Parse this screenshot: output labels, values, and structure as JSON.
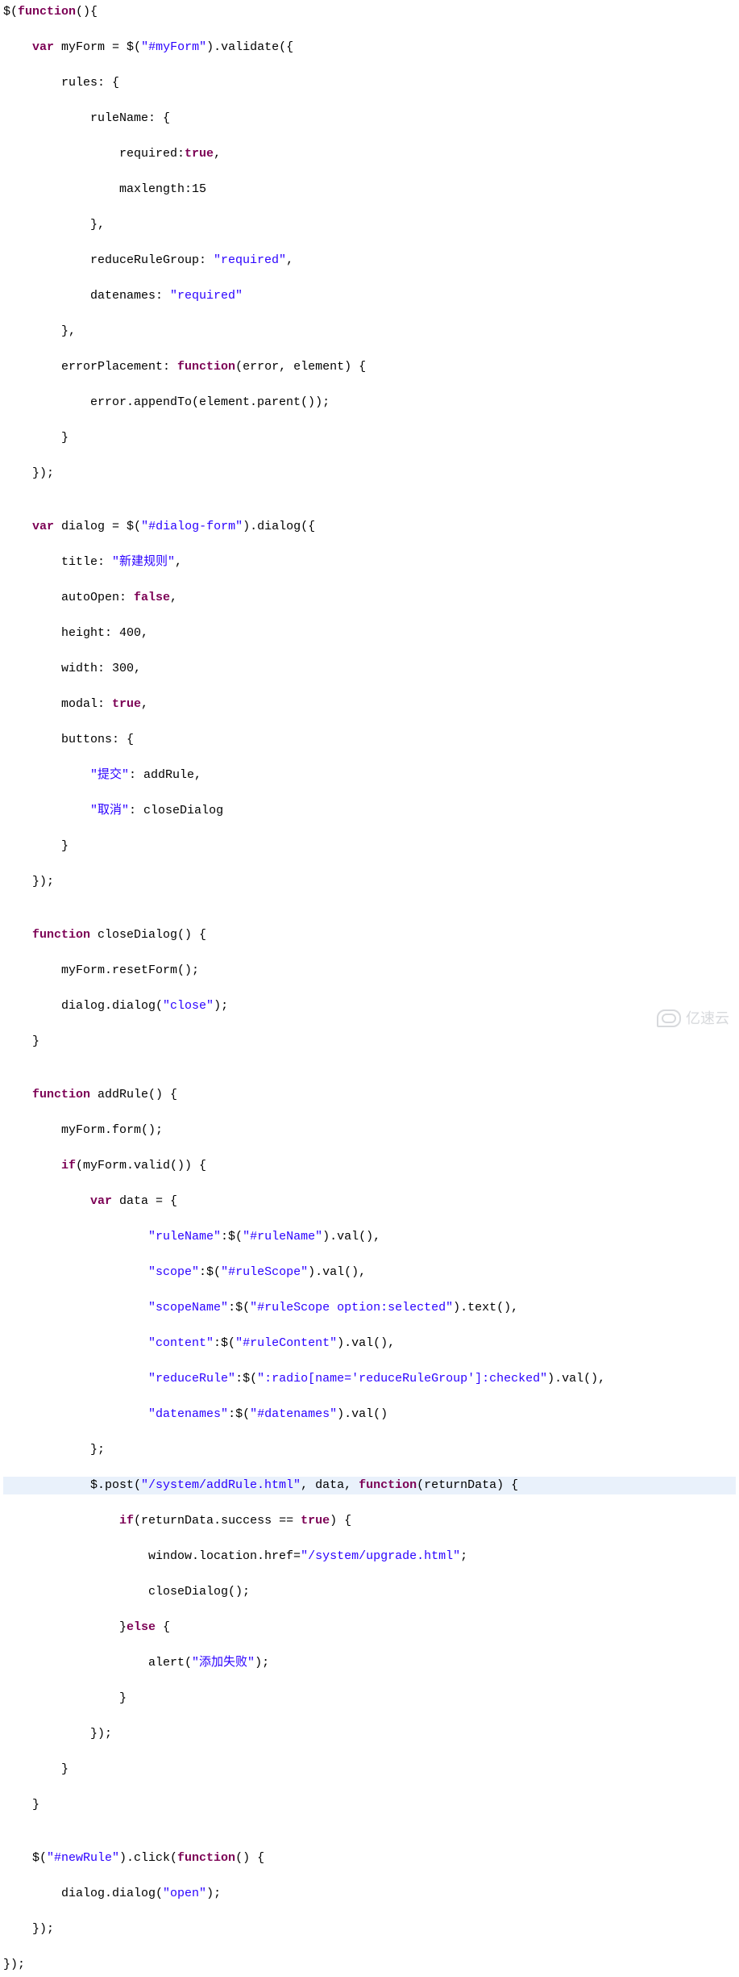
{
  "watermark": "亿速云",
  "lines": [
    {
      "hl": false,
      "tokens": [
        [
          "pl",
          "$("
        ],
        [
          "kw",
          "function"
        ],
        [
          "pl",
          "(){"
        ]
      ]
    },
    {
      "hl": false,
      "tokens": [
        [
          "pl",
          "    "
        ],
        [
          "kw",
          "var"
        ],
        [
          "pl",
          " myForm = $("
        ],
        [
          "str",
          "\"#myForm\""
        ],
        [
          "pl",
          ").validate({"
        ]
      ]
    },
    {
      "hl": false,
      "tokens": [
        [
          "pl",
          "        rules: {"
        ]
      ]
    },
    {
      "hl": false,
      "tokens": [
        [
          "pl",
          "            ruleName: {"
        ]
      ]
    },
    {
      "hl": false,
      "tokens": [
        [
          "pl",
          "                required:"
        ],
        [
          "kw",
          "true"
        ],
        [
          "pl",
          ","
        ]
      ]
    },
    {
      "hl": false,
      "tokens": [
        [
          "pl",
          "                maxlength:15"
        ]
      ]
    },
    {
      "hl": false,
      "tokens": [
        [
          "pl",
          "            },"
        ]
      ]
    },
    {
      "hl": false,
      "tokens": [
        [
          "pl",
          "            reduceRuleGroup: "
        ],
        [
          "str",
          "\"required\""
        ],
        [
          "pl",
          ","
        ]
      ]
    },
    {
      "hl": false,
      "tokens": [
        [
          "pl",
          "            datenames: "
        ],
        [
          "str",
          "\"required\""
        ]
      ]
    },
    {
      "hl": false,
      "tokens": [
        [
          "pl",
          "        },"
        ]
      ]
    },
    {
      "hl": false,
      "tokens": [
        [
          "pl",
          "        errorPlacement: "
        ],
        [
          "kw",
          "function"
        ],
        [
          "pl",
          "(error, element) {"
        ]
      ]
    },
    {
      "hl": false,
      "tokens": [
        [
          "pl",
          "            error.appendTo(element.parent());"
        ]
      ]
    },
    {
      "hl": false,
      "tokens": [
        [
          "pl",
          "        }"
        ]
      ]
    },
    {
      "hl": false,
      "tokens": [
        [
          "pl",
          "    });"
        ]
      ]
    },
    {
      "hl": false,
      "tokens": [
        [
          "pl",
          ""
        ]
      ]
    },
    {
      "hl": false,
      "tokens": [
        [
          "pl",
          "    "
        ],
        [
          "kw",
          "var"
        ],
        [
          "pl",
          " dialog = $("
        ],
        [
          "str",
          "\"#dialog-form\""
        ],
        [
          "pl",
          ").dialog({"
        ]
      ]
    },
    {
      "hl": false,
      "tokens": [
        [
          "pl",
          "        title: "
        ],
        [
          "str",
          "\"新建规则\""
        ],
        [
          "pl",
          ","
        ]
      ]
    },
    {
      "hl": false,
      "tokens": [
        [
          "pl",
          "        autoOpen: "
        ],
        [
          "kw",
          "false"
        ],
        [
          "pl",
          ","
        ]
      ]
    },
    {
      "hl": false,
      "tokens": [
        [
          "pl",
          "        height: 400,"
        ]
      ]
    },
    {
      "hl": false,
      "tokens": [
        [
          "pl",
          "        width: 300,"
        ]
      ]
    },
    {
      "hl": false,
      "tokens": [
        [
          "pl",
          "        modal: "
        ],
        [
          "kw",
          "true"
        ],
        [
          "pl",
          ","
        ]
      ]
    },
    {
      "hl": false,
      "tokens": [
        [
          "pl",
          "        buttons: {"
        ]
      ]
    },
    {
      "hl": false,
      "tokens": [
        [
          "pl",
          "            "
        ],
        [
          "str",
          "\"提交\""
        ],
        [
          "pl",
          ": addRule,"
        ]
      ]
    },
    {
      "hl": false,
      "tokens": [
        [
          "pl",
          "            "
        ],
        [
          "str",
          "\"取消\""
        ],
        [
          "pl",
          ": closeDialog"
        ]
      ]
    },
    {
      "hl": false,
      "tokens": [
        [
          "pl",
          "        }"
        ]
      ]
    },
    {
      "hl": false,
      "tokens": [
        [
          "pl",
          "    });"
        ]
      ]
    },
    {
      "hl": false,
      "tokens": [
        [
          "pl",
          ""
        ]
      ]
    },
    {
      "hl": false,
      "tokens": [
        [
          "pl",
          "    "
        ],
        [
          "kw",
          "function"
        ],
        [
          "pl",
          " closeDialog() {"
        ]
      ]
    },
    {
      "hl": false,
      "tokens": [
        [
          "pl",
          "        myForm.resetForm();"
        ]
      ]
    },
    {
      "hl": false,
      "tokens": [
        [
          "pl",
          "        dialog.dialog("
        ],
        [
          "str",
          "\"close\""
        ],
        [
          "pl",
          ");"
        ]
      ]
    },
    {
      "hl": false,
      "tokens": [
        [
          "pl",
          "    }"
        ]
      ]
    },
    {
      "hl": false,
      "tokens": [
        [
          "pl",
          ""
        ]
      ]
    },
    {
      "hl": false,
      "tokens": [
        [
          "pl",
          "    "
        ],
        [
          "kw",
          "function"
        ],
        [
          "pl",
          " addRule() {"
        ]
      ]
    },
    {
      "hl": false,
      "tokens": [
        [
          "pl",
          "        myForm.form();"
        ]
      ]
    },
    {
      "hl": false,
      "tokens": [
        [
          "pl",
          "        "
        ],
        [
          "kw",
          "if"
        ],
        [
          "pl",
          "(myForm.valid()) {"
        ]
      ]
    },
    {
      "hl": false,
      "tokens": [
        [
          "pl",
          "            "
        ],
        [
          "kw",
          "var"
        ],
        [
          "pl",
          " data = {"
        ]
      ]
    },
    {
      "hl": false,
      "tokens": [
        [
          "pl",
          "                    "
        ],
        [
          "str",
          "\"ruleName\""
        ],
        [
          "pl",
          ":$("
        ],
        [
          "str",
          "\"#ruleName\""
        ],
        [
          "pl",
          ").val(),"
        ]
      ]
    },
    {
      "hl": false,
      "tokens": [
        [
          "pl",
          "                    "
        ],
        [
          "str",
          "\"scope\""
        ],
        [
          "pl",
          ":$("
        ],
        [
          "str",
          "\"#ruleScope\""
        ],
        [
          "pl",
          ").val(),"
        ]
      ]
    },
    {
      "hl": false,
      "tokens": [
        [
          "pl",
          "                    "
        ],
        [
          "str",
          "\"scopeName\""
        ],
        [
          "pl",
          ":$("
        ],
        [
          "str",
          "\"#ruleScope option:selected\""
        ],
        [
          "pl",
          ").text(),"
        ]
      ]
    },
    {
      "hl": false,
      "tokens": [
        [
          "pl",
          "                    "
        ],
        [
          "str",
          "\"content\""
        ],
        [
          "pl",
          ":$("
        ],
        [
          "str",
          "\"#ruleContent\""
        ],
        [
          "pl",
          ").val(),"
        ]
      ]
    },
    {
      "hl": false,
      "tokens": [
        [
          "pl",
          "                    "
        ],
        [
          "str",
          "\"reduceRule\""
        ],
        [
          "pl",
          ":$("
        ],
        [
          "str",
          "\":radio[name='reduceRuleGroup']:checked\""
        ],
        [
          "pl",
          ").val(),"
        ]
      ]
    },
    {
      "hl": false,
      "tokens": [
        [
          "pl",
          "                    "
        ],
        [
          "str",
          "\"datenames\""
        ],
        [
          "pl",
          ":$("
        ],
        [
          "str",
          "\"#datenames\""
        ],
        [
          "pl",
          ").val()"
        ]
      ]
    },
    {
      "hl": false,
      "tokens": [
        [
          "pl",
          "            };"
        ]
      ]
    },
    {
      "hl": true,
      "tokens": [
        [
          "pl",
          "            $.post("
        ],
        [
          "str",
          "\"/system/addRule.html\""
        ],
        [
          "pl",
          ", data, "
        ],
        [
          "kw",
          "function"
        ],
        [
          "pl",
          "(returnData) {"
        ]
      ]
    },
    {
      "hl": false,
      "tokens": [
        [
          "pl",
          "                "
        ],
        [
          "kw",
          "if"
        ],
        [
          "pl",
          "(returnData.success == "
        ],
        [
          "kw",
          "true"
        ],
        [
          "pl",
          ") {"
        ]
      ]
    },
    {
      "hl": false,
      "tokens": [
        [
          "pl",
          "                    window.location.href="
        ],
        [
          "str",
          "\"/system/upgrade.html\""
        ],
        [
          "pl",
          ";"
        ]
      ]
    },
    {
      "hl": false,
      "tokens": [
        [
          "pl",
          "                    closeDialog();"
        ]
      ]
    },
    {
      "hl": false,
      "tokens": [
        [
          "pl",
          "                }"
        ],
        [
          "kw",
          "else"
        ],
        [
          "pl",
          " {"
        ]
      ]
    },
    {
      "hl": false,
      "tokens": [
        [
          "pl",
          "                    alert("
        ],
        [
          "str",
          "\"添加失败\""
        ],
        [
          "pl",
          ");"
        ]
      ]
    },
    {
      "hl": false,
      "tokens": [
        [
          "pl",
          "                }"
        ]
      ]
    },
    {
      "hl": false,
      "tokens": [
        [
          "pl",
          "            });"
        ]
      ]
    },
    {
      "hl": false,
      "tokens": [
        [
          "pl",
          "        }"
        ]
      ]
    },
    {
      "hl": false,
      "tokens": [
        [
          "pl",
          "    }"
        ]
      ]
    },
    {
      "hl": false,
      "tokens": [
        [
          "pl",
          ""
        ]
      ]
    },
    {
      "hl": false,
      "tokens": [
        [
          "pl",
          "    $("
        ],
        [
          "str",
          "\"#newRule\""
        ],
        [
          "pl",
          ").click("
        ],
        [
          "kw",
          "function"
        ],
        [
          "pl",
          "() {"
        ]
      ]
    },
    {
      "hl": false,
      "tokens": [
        [
          "pl",
          "        dialog.dialog("
        ],
        [
          "str",
          "\"open\""
        ],
        [
          "pl",
          ");"
        ]
      ]
    },
    {
      "hl": false,
      "tokens": [
        [
          "pl",
          "    });"
        ]
      ]
    },
    {
      "hl": false,
      "tokens": [
        [
          "pl",
          "});"
        ]
      ]
    }
  ]
}
